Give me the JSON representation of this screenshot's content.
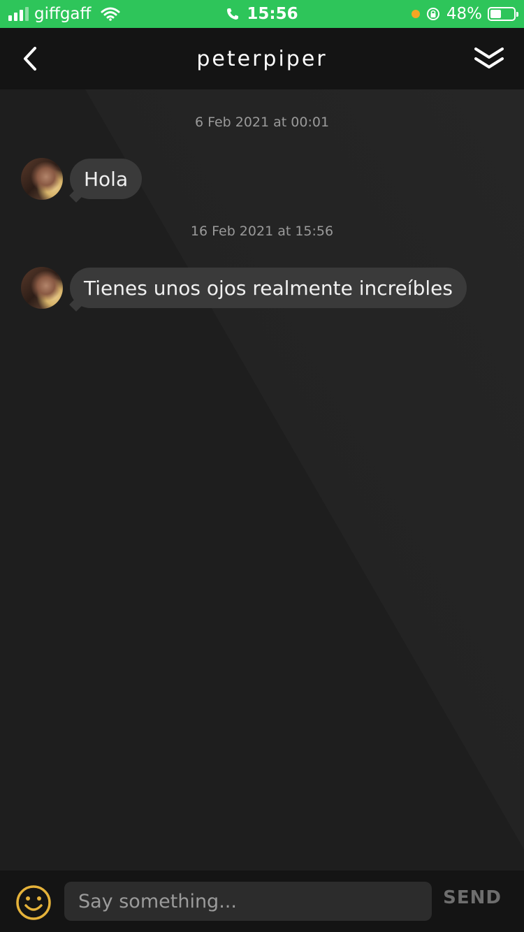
{
  "status_bar": {
    "carrier": "giffgaff",
    "time": "15:56",
    "battery_percent": "48%",
    "battery_level": 0.48,
    "signal_bars": 4,
    "signal_bars_filled": 3
  },
  "header": {
    "title": "peterpiper",
    "back_icon": "chevron-left-icon",
    "collapse_icon": "double-chevron-down-icon"
  },
  "messages": [
    {
      "timestamp": "6 Feb 2021 at 00:01",
      "text": "Hola"
    },
    {
      "timestamp": "16 Feb 2021 at 15:56",
      "text": "Tienes unos ojos realmente increíbles"
    }
  ],
  "composer": {
    "placeholder": "Say something...",
    "send_label": "SEND",
    "emoji_icon": "smiley-icon"
  },
  "colors": {
    "status_bar": "#2ec55a",
    "header_bg": "#141414",
    "chat_bg": "#1e1e1e",
    "bubble_bg": "#3a3a3a",
    "emoji_accent": "#e5b23a"
  }
}
